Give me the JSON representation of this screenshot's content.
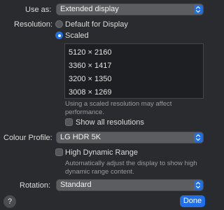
{
  "use_as": {
    "label": "Use as:",
    "value": "Extended display"
  },
  "resolution": {
    "label": "Resolution:",
    "options": [
      {
        "label": "Default for Display",
        "selected": false
      },
      {
        "label": "Scaled",
        "selected": true
      }
    ],
    "list": [
      "5120 × 2160",
      "3360 × 1417",
      "3200 × 1350",
      "3008 × 1269"
    ],
    "hint_line1": "Using a scaled resolution may affect",
    "hint_line2": "performance.",
    "show_all": {
      "label": "Show all resolutions",
      "checked": false
    }
  },
  "colour_profile": {
    "label": "Colour Profile:",
    "value": "LG HDR 5K"
  },
  "hdr": {
    "label": "High Dynamic Range",
    "checked": false,
    "desc_line1": "Automatically adjust the display to show high",
    "desc_line2": "dynamic range content."
  },
  "rotation": {
    "label": "Rotation:",
    "value": "Standard"
  },
  "buttons": {
    "help": "?",
    "done": "Done"
  },
  "colors": {
    "accent": "#1f6fe8",
    "background": "#2a2b2e"
  }
}
